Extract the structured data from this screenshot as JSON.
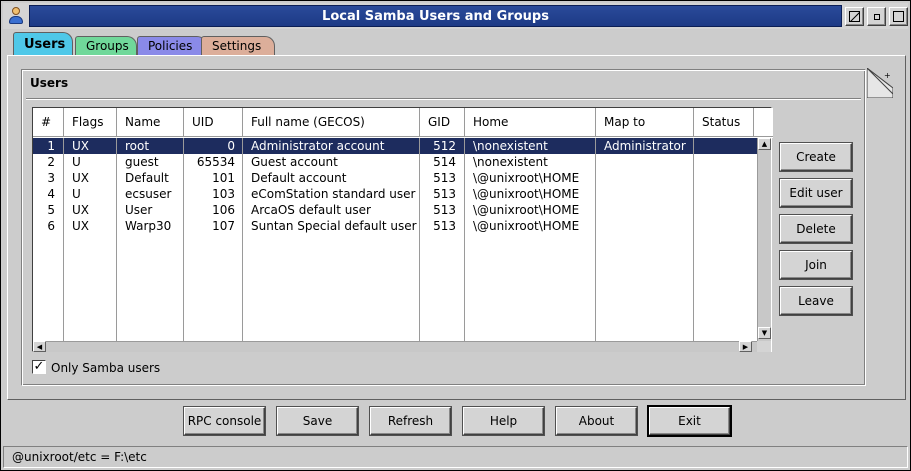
{
  "window": {
    "title": "Local Samba Users and Groups"
  },
  "tabs": [
    {
      "label": "Users",
      "color": "#4fc8e8",
      "active": true
    },
    {
      "label": "Groups",
      "color": "#70d89a",
      "active": false
    },
    {
      "label": "Policies",
      "color": "#8a8ae8",
      "active": false
    },
    {
      "label": "Settings",
      "color": "#dcae9a",
      "active": false
    }
  ],
  "group": {
    "title": "Users"
  },
  "table": {
    "columns": [
      "#",
      "Flags",
      "Name",
      "UID",
      "Full name (GECOS)",
      "GID",
      "Home",
      "Map to",
      "Status"
    ],
    "rows": [
      {
        "num": "1",
        "flags": "UX",
        "name": "root",
        "uid": "0",
        "fullname": "Administrator account",
        "gid": "512",
        "home": "\\nonexistent",
        "mapto": "Administrator",
        "status": "",
        "selected": true
      },
      {
        "num": "2",
        "flags": "U",
        "name": "guest",
        "uid": "65534",
        "fullname": "Guest account",
        "gid": "514",
        "home": "\\nonexistent",
        "mapto": "",
        "status": "",
        "selected": false
      },
      {
        "num": "3",
        "flags": "UX",
        "name": "Default",
        "uid": "101",
        "fullname": "Default account",
        "gid": "513",
        "home": "\\@unixroot\\HOME",
        "mapto": "",
        "status": "",
        "selected": false
      },
      {
        "num": "4",
        "flags": "U",
        "name": "ecsuser",
        "uid": "103",
        "fullname": "eComStation standard user",
        "gid": "513",
        "home": "\\@unixroot\\HOME",
        "mapto": "",
        "status": "",
        "selected": false
      },
      {
        "num": "5",
        "flags": "UX",
        "name": "User",
        "uid": "106",
        "fullname": "ArcaOS default user",
        "gid": "513",
        "home": "\\@unixroot\\HOME",
        "mapto": "",
        "status": "",
        "selected": false
      },
      {
        "num": "6",
        "flags": "UX",
        "name": "Warp30",
        "uid": "107",
        "fullname": "Suntan Special default user",
        "gid": "513",
        "home": "\\@unixroot\\HOME",
        "mapto": "",
        "status": "",
        "selected": false
      }
    ]
  },
  "side_buttons": {
    "create": "Create",
    "edit_user": "Edit user",
    "delete": "Delete",
    "join": "Join",
    "leave": "Leave"
  },
  "checkbox": {
    "label": "Only Samba users",
    "checked": true,
    "mark": "✓"
  },
  "bottom_buttons": {
    "rpc_console": "RPC console",
    "save": "Save",
    "refresh": "Refresh",
    "help": "Help",
    "about": "About",
    "exit": "Exit"
  },
  "statusbar": {
    "text": "@unixroot/etc = F:\\etc"
  },
  "scrollbar": {
    "up": "▲",
    "down": "▼",
    "left": "◀",
    "right": "▶"
  }
}
